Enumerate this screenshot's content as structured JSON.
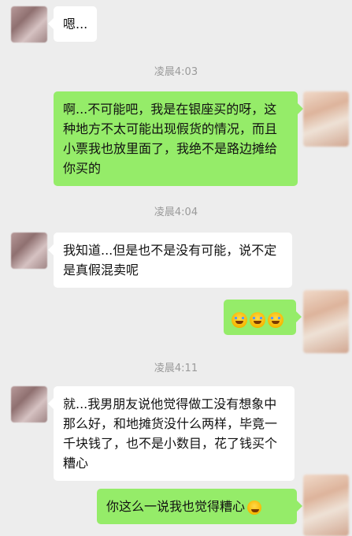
{
  "messages": {
    "m1": "嗯...",
    "t1": "凌晨4:03",
    "m2": "啊...不可能吧，我是在银座买的呀，这种地方不太可能出现假货的情况，而且小票我也放里面了，我绝不是路边摊给你买的",
    "t2": "凌晨4:04",
    "m3": "我知道...但是也不是没有可能，说不定是真假混卖呢",
    "t3": "凌晨4:11",
    "m4": "就...我男朋友说他觉得做工没有想象中那么好，和地摊货没什么两样，毕竟一千块钱了，也不是小数目，花了钱买个糟心",
    "m5": "你这么一说我也觉得糟心"
  },
  "icons": {
    "cry_emoji": "loudly-crying-face",
    "awkward_emoji": "awkward-smile"
  },
  "colors": {
    "background": "#ededed",
    "sent_bubble": "#95ec69",
    "received_bubble": "#ffffff",
    "timestamp": "#9a9a9a"
  }
}
